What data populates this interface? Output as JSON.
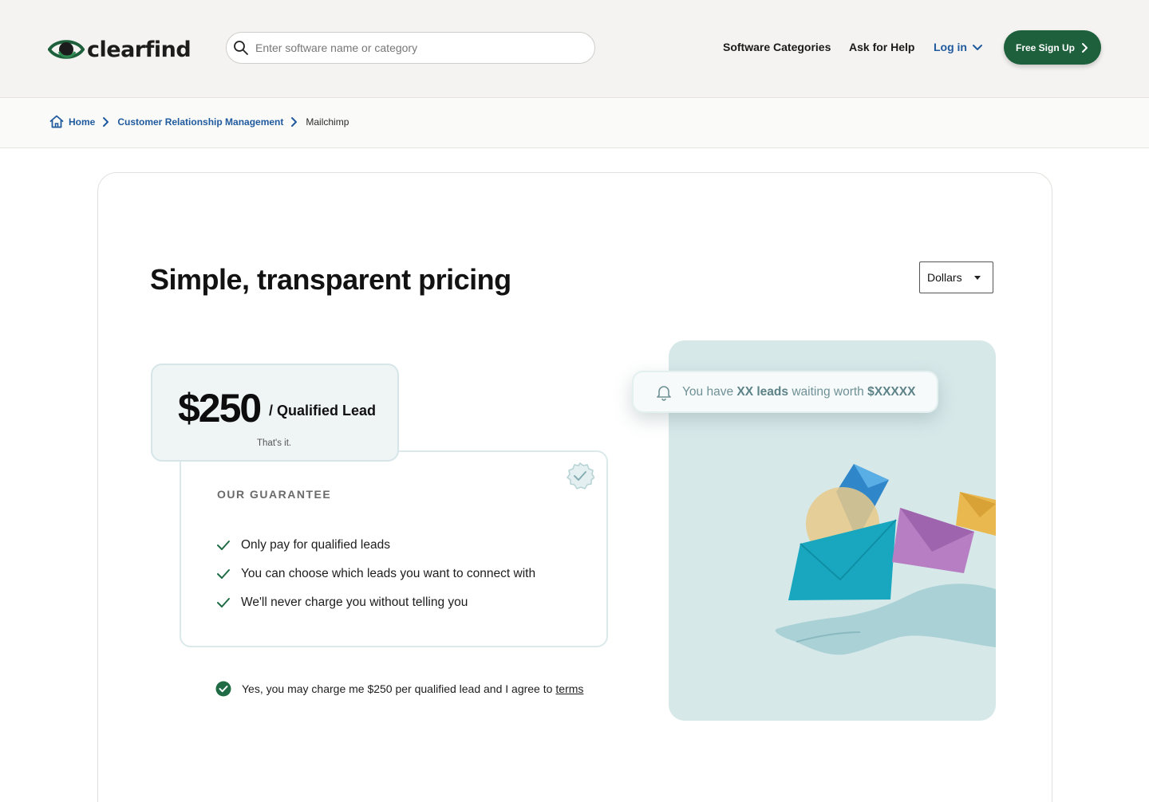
{
  "header": {
    "logo_text": "clearfind",
    "search_placeholder": "Enter software name or category",
    "nav": {
      "categories": "Software Categories",
      "help": "Ask for Help",
      "login": "Log in"
    },
    "signup_label": "Free Sign Up",
    "brand_color": "#1e5f3c"
  },
  "breadcrumb": {
    "home": "Home",
    "category": "Customer Relationship Management",
    "current": "Mailchimp"
  },
  "main": {
    "title": "Simple, transparent pricing",
    "currency": "Dollars",
    "price": {
      "amount": "$250",
      "unit": "/ Qualified Lead",
      "note": "That's it."
    },
    "guarantee": {
      "title": "OUR GUARANTEE",
      "items": [
        "Only pay for qualified leads",
        "You can choose which leads you want to connect with",
        "We'll never charge you without telling you"
      ]
    },
    "agree": {
      "text": "Yes, you may charge me $250 per qualified lead and I agree to",
      "link": "terms"
    },
    "notification": {
      "prefix": "You have",
      "leads": "XX leads",
      "middle": "waiting worth",
      "amount": "$XXXXX"
    }
  }
}
